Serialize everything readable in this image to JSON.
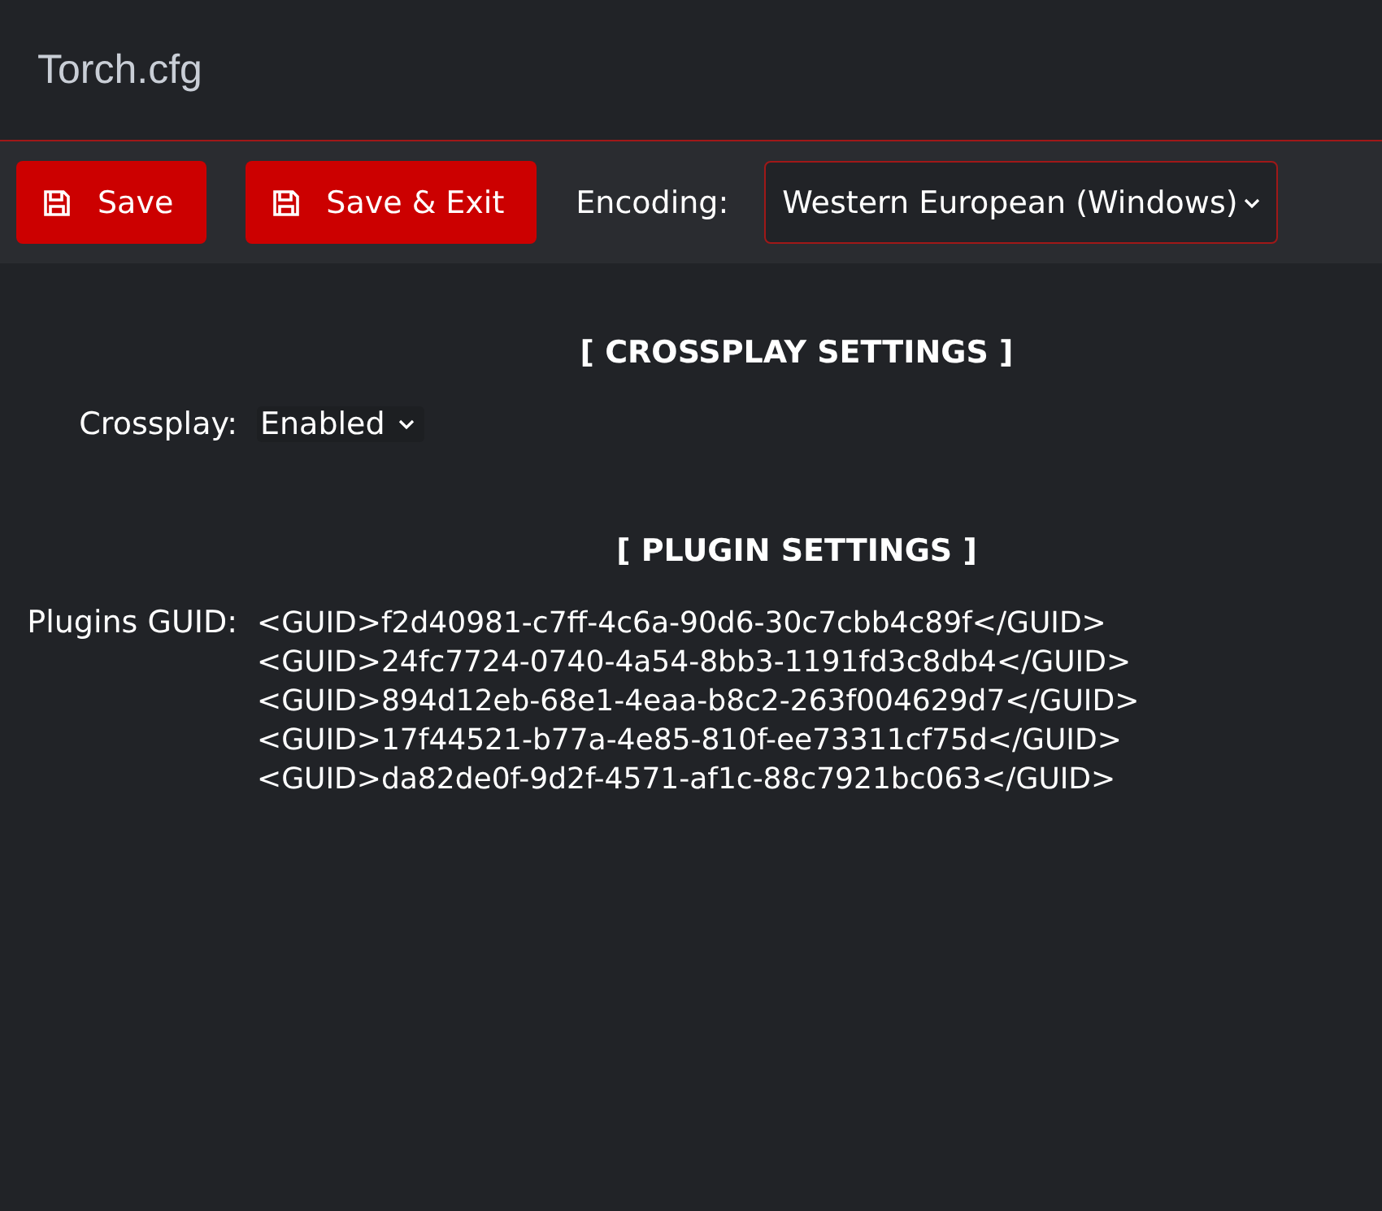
{
  "window": {
    "title": "Torch.cfg"
  },
  "toolbar": {
    "buttons": [
      "Save",
      "Save & Exit"
    ],
    "encoding": {
      "label": "Encoding:",
      "value": "Western European (Windows)"
    }
  },
  "sections": [
    {
      "heading": "[ CROSSPLAY SETTINGS ]",
      "fields": [
        {
          "kind": "select",
          "label": "Crossplay:",
          "value": "Enabled"
        }
      ]
    },
    {
      "heading": "[ PLUGIN SETTINGS ]",
      "fields": [
        {
          "kind": "lines",
          "label": "Plugins GUID:",
          "lines": [
            "<GUID>f2d40981-c7ff-4c6a-90d6-30c7cbb4c89f</GUID>",
            "<GUID>24fc7724-0740-4a54-8bb3-1191fd3c8db4</GUID>",
            "<GUID>894d12eb-68e1-4eaa-b8c2-263f004629d7</GUID>",
            "<GUID>17f44521-b77a-4e85-810f-ee73311cf75d</GUID>",
            "<GUID>da82de0f-9d2f-4571-af1c-88c7921bc063</GUID>"
          ]
        }
      ]
    }
  ]
}
